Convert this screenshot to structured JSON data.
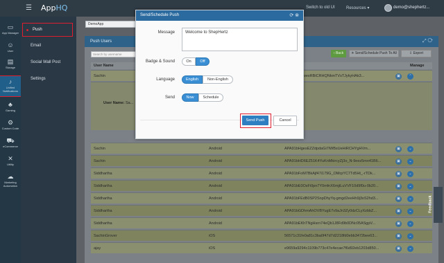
{
  "topbar": {
    "logo_prefix": "App",
    "logo_suffix": "HQ",
    "switch_label": "Switch to old UI",
    "resources_label": "Resources ▾",
    "user_email": "demo@shephertz..."
  },
  "rail": [
    {
      "label": "App Manager",
      "icon": "monitor-icon",
      "glyph": "▭"
    },
    {
      "label": "User",
      "icon": "users-icon",
      "glyph": "☺"
    },
    {
      "label": "Storage",
      "icon": "database-icon",
      "glyph": "▤"
    },
    {
      "label": "Unified Notifications",
      "icon": "bell-icon",
      "glyph": "♪"
    },
    {
      "label": "Gaming",
      "icon": "gamepad-icon",
      "glyph": "♣"
    },
    {
      "label": "Custom Code",
      "icon": "code-icon",
      "glyph": "⚙"
    },
    {
      "label": "eCommerce",
      "icon": "cart-icon",
      "glyph": "⛟"
    },
    {
      "label": "Utility",
      "icon": "wrench-icon",
      "glyph": "✕"
    },
    {
      "label": "Marketing Automation",
      "icon": "megaphone-icon",
      "glyph": "☁"
    }
  ],
  "submenu": [
    "Push",
    "Email",
    "Social Wall Post",
    "Settings"
  ],
  "page": {
    "app_select": "DemoApp",
    "panel_title": "Push Users",
    "search_placeholder": "Search by username",
    "back_label": "‹ Back",
    "send_all_label": "✈ Send/Schedule Push To All",
    "export_label": "⇩ Export",
    "col_user": "User Name",
    "col_manage": "Manage",
    "expanded_label": "User Name:",
    "expanded_value": "Sa...",
    "rows": [
      {
        "name": "Sachin",
        "os": "",
        "token": "...YhJqtOHwesRBiCRHQNkmTVsTJykyHAk3..."
      },
      {
        "name": "Sachin",
        "os": "Android",
        "token": "APA91bHgesEZZdpdaGi7iWBsUeHiRCHYgHVm..."
      },
      {
        "name": "Sachin",
        "os": "Android",
        "token": "APA91bHD6EZ51K4YuKnMkircyZj3o_N-9eez5mn41B6..."
      },
      {
        "name": "Siddhartha",
        "os": "Android",
        "token": "APA91bFoM7BkAjf47i179G_OMrpYC7Td5Ht_-rTDk..."
      },
      {
        "name": "Siddhartha",
        "os": "Android",
        "token": "APA91bE0OsFi0pn7Y0mfnX6mjtLuVVF10d9f0u-0b20..."
      },
      {
        "name": "Siddhartha",
        "os": "Android",
        "token": "APA91bFEdB0SP2SnpDhyYq-gmgd2eeHh9j3oS2hd3..."
      },
      {
        "name": "Siddhartha",
        "os": "Android",
        "token": "APA91bGDhmAhOVBYugE7v9aJn3Zy0dzCLyXzbbZ..."
      },
      {
        "name": "Siddhartha",
        "os": "Android",
        "token": "APA91bEKhTNgHsrn74eQb1J8Fd9b0DNc05ASgpV..."
      },
      {
        "name": "SachinGrover",
        "os": "iOS",
        "token": "56571c31fe0a81c3ba0f47d7d2218fd0ebb3472bee63..."
      },
      {
        "name": "ajay",
        "os": "iOS",
        "token": "e9659a9294c1109b773c47e4ecae7f6d92eb1203d850..."
      }
    ]
  },
  "modal": {
    "title": "Send/Schedule Push",
    "message_label": "Message",
    "message_value": "Welcome to ShepHertz",
    "badge_label": "Badge & Sound",
    "badge_on": "On",
    "badge_off": "Off",
    "language_label": "Language",
    "lang_english": "English",
    "lang_non_english": "Non-English",
    "send_label": "Send",
    "send_now": "Now",
    "send_schedule": "Schedule",
    "send_push_button": "Send Push",
    "cancel_button": "Cancel"
  },
  "feedback": "Feedback",
  "colors": {
    "topbar": "#2f3b45",
    "primary": "#2d7fc1",
    "highlight": "#e01e2e"
  }
}
